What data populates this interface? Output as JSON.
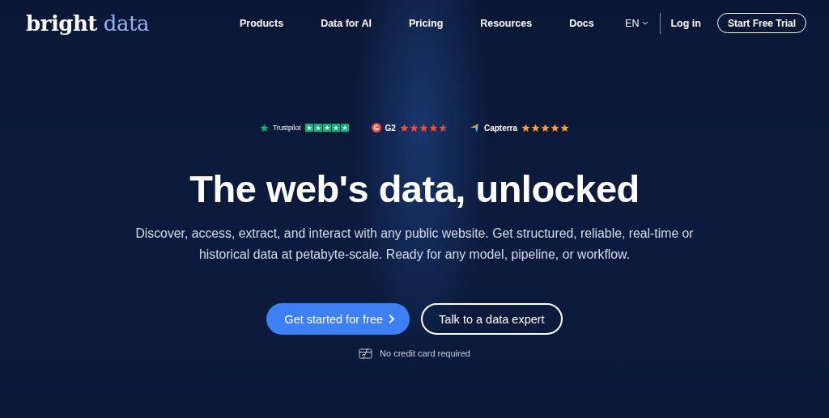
{
  "logo": {
    "primary": "bright",
    "secondary": "data"
  },
  "nav": {
    "items": [
      "Products",
      "Data for AI",
      "Pricing",
      "Resources",
      "Docs"
    ],
    "language": "EN",
    "login": "Log in",
    "cta": "Start Free Trial"
  },
  "ratings": [
    {
      "kind": "trustpilot",
      "name": "Trustpilot",
      "stars": 5
    },
    {
      "kind": "g2",
      "name": "G2",
      "stars": 4.5
    },
    {
      "kind": "capterra",
      "name": "Capterra",
      "stars": 5
    }
  ],
  "hero": {
    "title": "The web's data, unlocked",
    "subtitle": "Discover, access, extract, and interact with any public website. Get structured, reliable, real-time or historical data at petabyte-scale. Ready for any model, pipeline, or workflow.",
    "primary_button": "Get started for free",
    "secondary_button": "Talk to a data expert",
    "note": "No credit card required"
  }
}
